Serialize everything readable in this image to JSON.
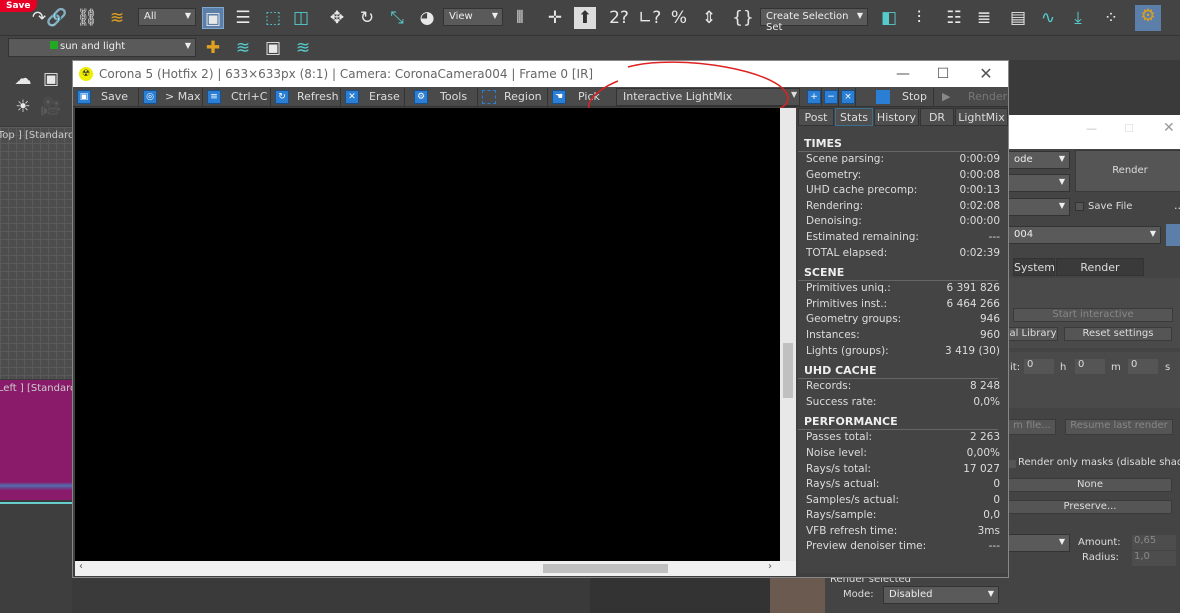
{
  "pinterest": {
    "save": "Save"
  },
  "main_toolbar": {
    "selection_filter": "All",
    "view_dropdown": "View",
    "create_selection_set": "Create Selection Set",
    "layer": "sun and light"
  },
  "viewports": {
    "top_label": "[Top ] [Standarc",
    "left_label": "[Left ] [Standarc"
  },
  "vfb": {
    "title": "Corona 5 (Hotfix 2) | 633×633px (8:1) | Camera: CoronaCamera004 | Frame 0 [IR]",
    "toolbar": {
      "save": "Save",
      "max": "> Max",
      "copy": "Ctrl+C",
      "refresh": "Refresh",
      "erase": "Erase",
      "tools": "Tools",
      "region": "Region",
      "pick": "Pick",
      "channel": "Interactive LightMix",
      "stop": "Stop",
      "render": "Render"
    },
    "tabs": [
      {
        "label": "Post"
      },
      {
        "label": "Stats"
      },
      {
        "label": "History"
      },
      {
        "label": "DR"
      },
      {
        "label": "LightMix"
      }
    ],
    "sections": [
      {
        "title": "TIMES",
        "rows": [
          [
            "Scene parsing:",
            "0:00:09"
          ],
          [
            "Geometry:",
            "0:00:08"
          ],
          [
            "UHD cache precomp:",
            "0:00:13"
          ],
          [
            "Rendering:",
            "0:02:08"
          ],
          [
            "Denoising:",
            "0:00:00"
          ],
          [
            "Estimated remaining:",
            "---"
          ],
          [
            "TOTAL elapsed:",
            "0:02:39"
          ]
        ]
      },
      {
        "title": "SCENE",
        "rows": [
          [
            "Primitives uniq.:",
            "6 391 826"
          ],
          [
            "Primitives inst.:",
            "6 464 266"
          ],
          [
            "Geometry groups:",
            "946"
          ],
          [
            "Instances:",
            "960"
          ],
          [
            "Lights (groups):",
            "3 419 (30)"
          ]
        ]
      },
      {
        "title": "UHD CACHE",
        "rows": [
          [
            "Records:",
            "8 248"
          ],
          [
            "Success rate:",
            "0,0%"
          ]
        ]
      },
      {
        "title": "PERFORMANCE",
        "rows": [
          [
            "Passes total:",
            "2 263"
          ],
          [
            "Noise level:",
            "0,00%"
          ],
          [
            "Rays/s total:",
            "17 027"
          ],
          [
            "Rays/s actual:",
            "0"
          ],
          [
            "Samples/s actual:",
            "0"
          ],
          [
            "Rays/sample:",
            "0,0"
          ],
          [
            "VFB refresh time:",
            "3ms"
          ],
          [
            "Preview denoiser time:",
            "---"
          ]
        ]
      }
    ]
  },
  "render_setup": {
    "mode_dropdown": "ode",
    "render": "Render",
    "save_file": "Save File",
    "more": "...",
    "camera": "004",
    "tabs": [
      "System",
      "Render Elements"
    ],
    "start_interactive": "Start interactive",
    "library": "al Library",
    "reset": "Reset settings",
    "time_label": "it:",
    "h_val": "0",
    "h": "h",
    "m_val": "0",
    "m": "m",
    "s_val": "0",
    "s": "s",
    "from_file": "m file...",
    "resume": "Resume last render",
    "masks": "Render only masks (disable shading)",
    "none": "None",
    "preserve": "Preserve...",
    "amount_label": "Amount:",
    "amount": "0,65",
    "radius_label": "Radius:",
    "radius": "1,0",
    "render_selected": "Render selected",
    "mode_label": "Mode:",
    "mode": "Disabled"
  }
}
